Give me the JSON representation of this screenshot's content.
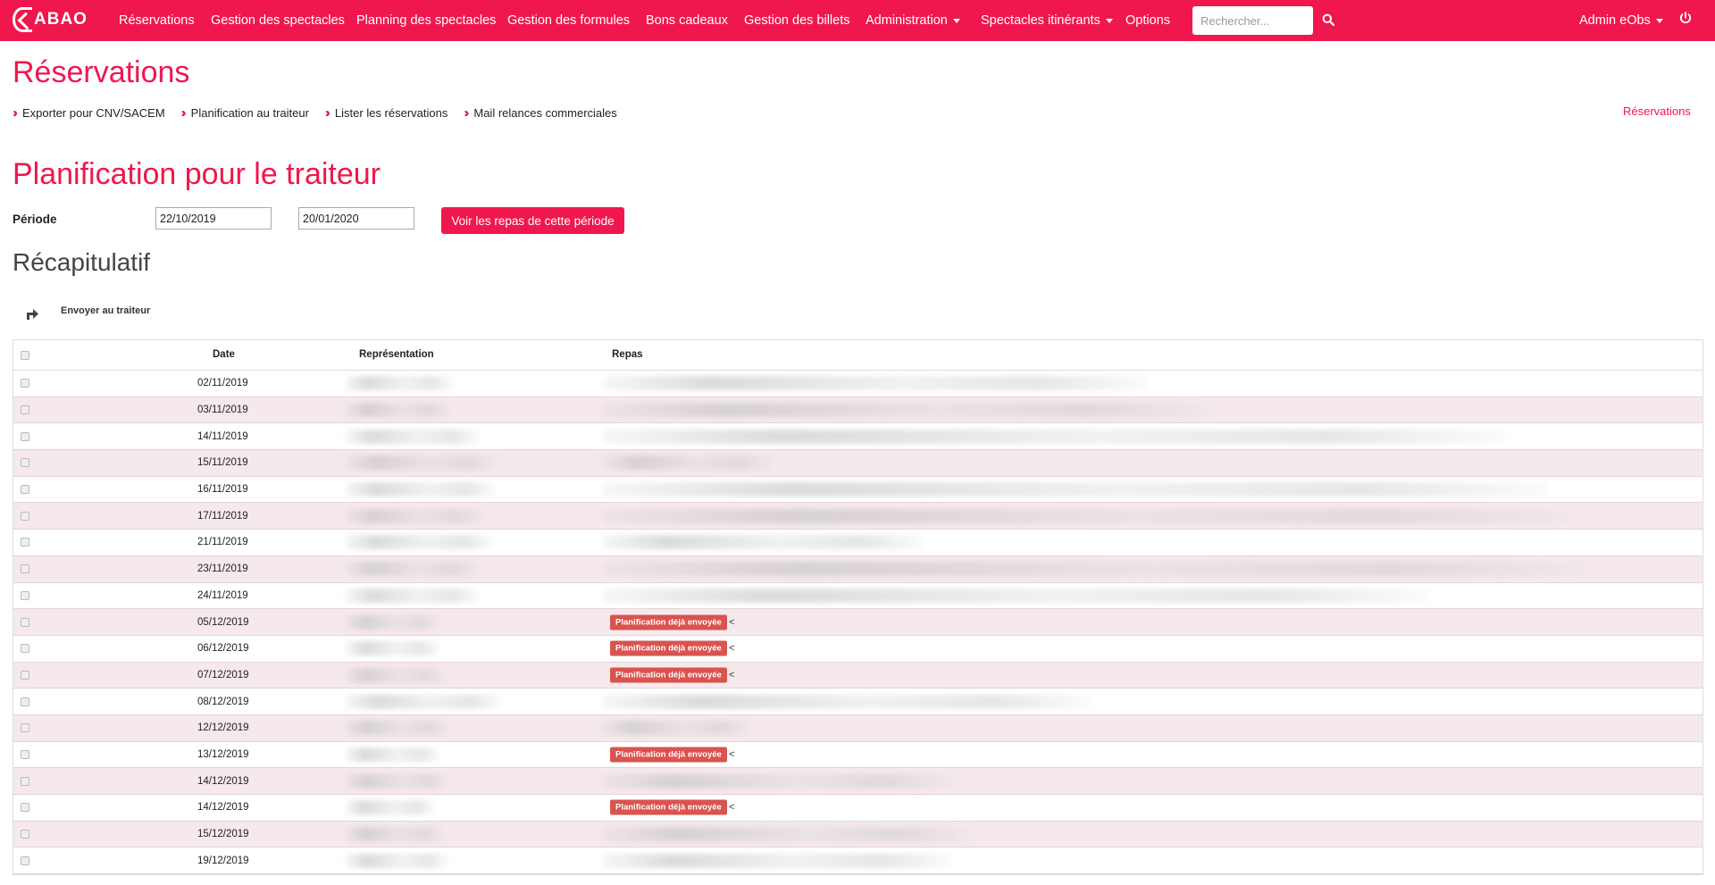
{
  "app": {
    "logo_text": "ABAO"
  },
  "nav": {
    "items": [
      {
        "label": "Réservations"
      },
      {
        "label": "Gestion des spectacles"
      },
      {
        "label": "Planning des spectacles"
      },
      {
        "label": "Gestion des formules"
      },
      {
        "label": "Bons cadeaux"
      },
      {
        "label": "Gestion des billets"
      },
      {
        "label": "Administration"
      },
      {
        "label": "Spectacles itinérants"
      },
      {
        "label": "Options"
      }
    ],
    "search_placeholder": "Rechercher...",
    "user_label": "Admin eObs"
  },
  "page": {
    "title": "Réservations",
    "breadcrumb_right": "Réservations",
    "subnav": [
      {
        "label": "Exporter pour CNV/SACEM"
      },
      {
        "label": "Planification au traiteur"
      },
      {
        "label": "Lister les réservations"
      },
      {
        "label": "Mail relances commerciales"
      }
    ],
    "section_title": "Planification pour le traiteur",
    "periode_label": "Période",
    "date_from": "22/10/2019",
    "date_to": "20/01/2020",
    "submit_label": "Voir les repas de cette période",
    "recap_title": "Récapitulatif",
    "send_label": "Envoyer au traiteur"
  },
  "table": {
    "headers": {
      "date": "Date",
      "representation": "Représentation",
      "repas": "Repas"
    },
    "badge_label": "Planification déjà envoyée",
    "badge_suffix": "<",
    "rows": [
      {
        "date": "02/11/2019",
        "sent": false
      },
      {
        "date": "03/11/2019",
        "sent": false
      },
      {
        "date": "14/11/2019",
        "sent": false
      },
      {
        "date": "15/11/2019",
        "sent": false
      },
      {
        "date": "16/11/2019",
        "sent": false
      },
      {
        "date": "17/11/2019",
        "sent": false
      },
      {
        "date": "21/11/2019",
        "sent": false
      },
      {
        "date": "23/11/2019",
        "sent": false
      },
      {
        "date": "24/11/2019",
        "sent": false
      },
      {
        "date": "05/12/2019",
        "sent": true
      },
      {
        "date": "06/12/2019",
        "sent": true
      },
      {
        "date": "07/12/2019",
        "sent": true
      },
      {
        "date": "08/12/2019",
        "sent": false
      },
      {
        "date": "12/12/2019",
        "sent": false
      },
      {
        "date": "13/12/2019",
        "sent": true
      },
      {
        "date": "14/12/2019",
        "sent": false
      },
      {
        "date": "14/12/2019",
        "sent": true
      },
      {
        "date": "15/12/2019",
        "sent": false
      },
      {
        "date": "19/12/2019",
        "sent": false
      }
    ]
  }
}
